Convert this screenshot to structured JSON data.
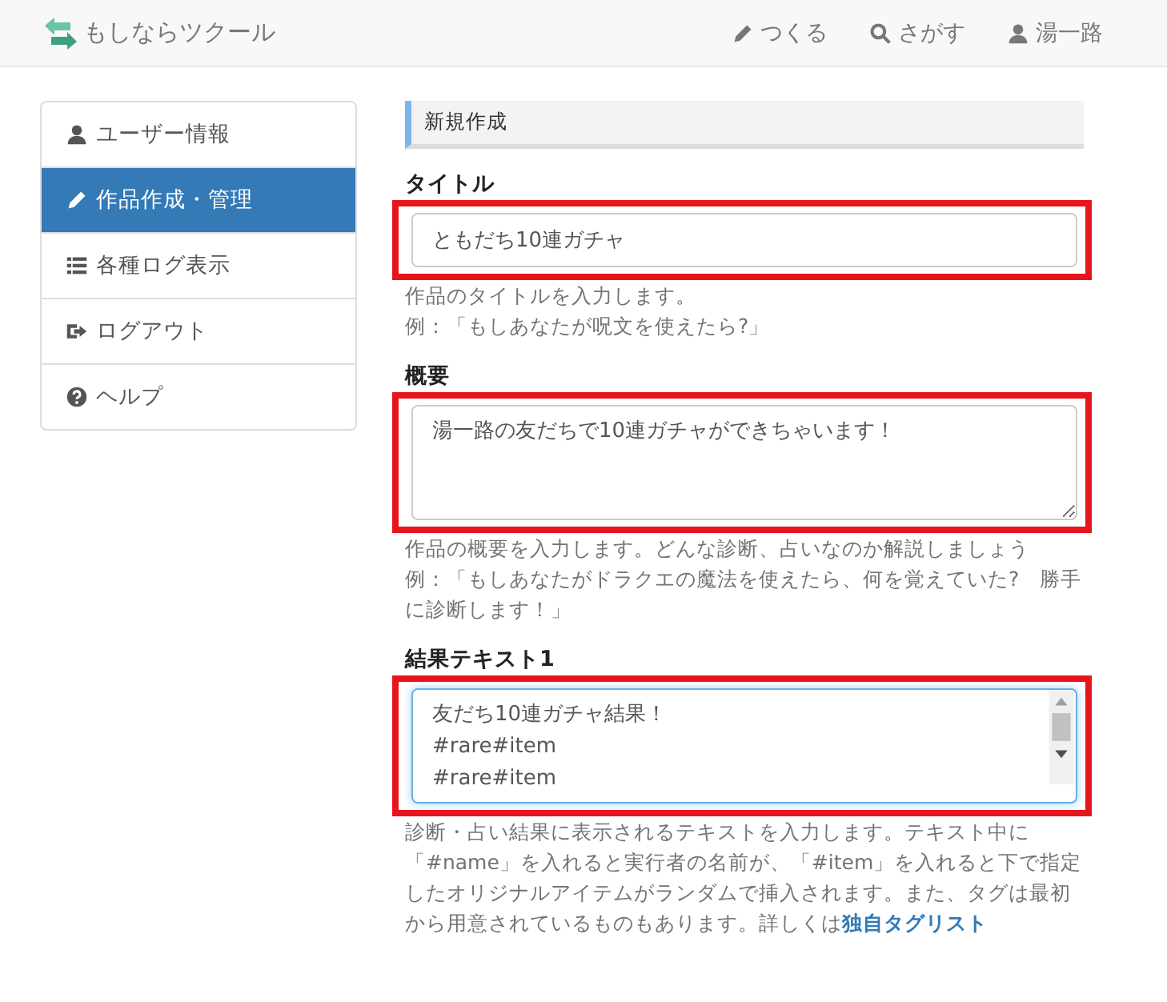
{
  "navbar": {
    "brand": "もしならツクール",
    "links": [
      {
        "kind": "pencil",
        "label": "つくる"
      },
      {
        "kind": "search",
        "label": "さがす"
      },
      {
        "kind": "user",
        "label": "湯一路"
      }
    ]
  },
  "sidebar": {
    "items": [
      {
        "kind": "user",
        "label": "ユーザー情報",
        "selected": false
      },
      {
        "kind": "pencil",
        "label": "作品作成・管理",
        "selected": true
      },
      {
        "kind": "list",
        "label": "各種ログ表示",
        "selected": false
      },
      {
        "kind": "logout",
        "label": "ログアウト",
        "selected": false
      },
      {
        "kind": "help",
        "label": "ヘルプ",
        "selected": false
      }
    ]
  },
  "section_title": "新規作成",
  "fields": [
    {
      "kind": "input",
      "label": "タイトル",
      "value": "ともだち10連ガチャ",
      "highlighted": true,
      "focused": false,
      "help": [
        "作品のタイトルを入力します。",
        "例：「もしあなたが呪文を使えたら?」"
      ]
    },
    {
      "kind": "textarea",
      "label": "概要",
      "value": "湯一路の友だちで10連ガチャができちゃいます！",
      "highlighted": true,
      "focused": false,
      "help": [
        "作品の概要を入力します。どんな診断、占いなのか解説しましょう",
        "例：「もしあなたがドラクエの魔法を使えたら、何を覚えていた?　勝手に診断します！」"
      ]
    },
    {
      "kind": "textarea-scroll",
      "label": "結果テキスト1",
      "value": "友だち10連ガチャ結果！\n#rare#item\n#rare#item",
      "highlighted": true,
      "focused": true,
      "help": [
        "診断・占い結果に表示されるテキストを入力します。テキスト中に「#name」を入れると実行者の名前が、「#item」を入れると下で指定したオリジナルアイテムがランダムで挿入されます。また、タグは最初から用意されているものもあります。詳しくは"
      ],
      "help_link": "独自タグリスト"
    }
  ]
}
